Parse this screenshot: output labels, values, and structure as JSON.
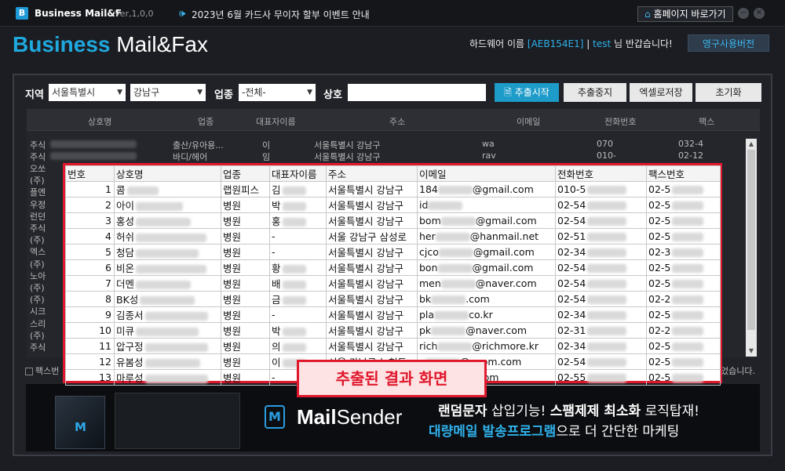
{
  "titlebar": {
    "logo_letter": "B",
    "app_name": "Business Mail&F",
    "version": "Ver,1,0,0",
    "notice": "2023년 6월 카드사 무이자 할부 이벤트 안내",
    "home_button": "홈페이지 바로가기"
  },
  "header": {
    "brand_bold": "Business",
    "brand_rest": "Mail&Fax",
    "hw_prefix": "하드웨어 이름",
    "hw_id": "[AEB154E1]",
    "sep": "|",
    "user": "test",
    "greeting": "님 반갑습니다!",
    "permanent_button": "영구사용버전"
  },
  "search": {
    "region_label": "지역",
    "region_value": "서울특별시",
    "district_value": "강남구",
    "industry_label": "업종",
    "industry_value": "-전체-",
    "company_label": "상호",
    "start_button": "추출시작",
    "stop_button": "추출중지",
    "excel_button": "엑셀로저장",
    "reset_button": "초기화"
  },
  "grid": {
    "headers": [
      "상호명",
      "업종",
      "대표자이름",
      "주소",
      "이메일",
      "전화번호",
      "팩스"
    ],
    "row1": {
      "name": "주식",
      "industry": "출산/유아용...",
      "rep": "이",
      "addr": "서울특별시 강남구",
      "email": "wa",
      "tel": "070",
      "fax": "032-4"
    },
    "row2": {
      "name": "주식",
      "industry": "바디/헤어",
      "rep": "임",
      "addr": "서울특별시 강남구",
      "email": "rav",
      "tel": "010-",
      "fax": "02-12"
    },
    "left_names": [
      "오쏘",
      "(주)",
      "플엔",
      "우정",
      "런던",
      "주식",
      "(주)",
      "엑스",
      "(주)",
      "노아",
      "(주)",
      "(주)",
      "시크",
      "스리",
      "(주)",
      "주식"
    ],
    "fax_check_label": "팩스번",
    "right_note": "었습니다."
  },
  "popup": {
    "headers": [
      "번호",
      "상호명",
      "업종",
      "대표자이름",
      "주소",
      "이메일",
      "전화번호",
      "팩스번호"
    ],
    "rows": [
      {
        "no": "1",
        "name": "콤",
        "industry": "랩원피스",
        "rep": "김",
        "addr": "서울특별시 강남구",
        "email_pre": "184",
        "email_post": "@gmail.com",
        "tel": "010-5",
        "fax": "02-5"
      },
      {
        "no": "2",
        "name": "아이",
        "industry": "병원",
        "rep": "박",
        "addr": "서울특별시 강남구",
        "email_pre": "id",
        "email_post": "",
        "tel": "02-54",
        "fax": "02-5"
      },
      {
        "no": "3",
        "name": "홍성",
        "industry": "병원",
        "rep": "홍",
        "addr": "서울특별시 강남구",
        "email_pre": "bom",
        "email_post": "@gmail.com",
        "tel": "02-54",
        "fax": "02-5"
      },
      {
        "no": "4",
        "name": "허쉬",
        "industry": "병원",
        "rep": "-",
        "addr": "서울 강남구 삼성로",
        "email_pre": "her",
        "email_post": "@hanmail.net",
        "tel": "02-51",
        "fax": "02-5"
      },
      {
        "no": "5",
        "name": "청담",
        "industry": "병원",
        "rep": "-",
        "addr": "서울특별시 강남구",
        "email_pre": "cjco",
        "email_post": "@gmail.com",
        "tel": "02-34",
        "fax": "02-3"
      },
      {
        "no": "6",
        "name": "비온",
        "industry": "병원",
        "rep": "황",
        "addr": "서울특별시 강남구",
        "email_pre": "bon",
        "email_post": "@gmail.com",
        "tel": "02-54",
        "fax": "02-5"
      },
      {
        "no": "7",
        "name": "더멘",
        "industry": "병원",
        "rep": "배",
        "addr": "서울특별시 강남구",
        "email_pre": "men",
        "email_post": "@naver.com",
        "tel": "02-54",
        "fax": "02-5"
      },
      {
        "no": "8",
        "name": "BK성",
        "industry": "병원",
        "rep": "금",
        "addr": "서울특별시 강남구",
        "email_pre": "bk",
        "email_post": ".com",
        "tel": "02-54",
        "fax": "02-2"
      },
      {
        "no": "9",
        "name": "김종서",
        "industry": "병원",
        "rep": "-",
        "addr": "서울특별시 강남구",
        "email_pre": "pla",
        "email_post": "co.kr",
        "tel": "02-34",
        "fax": "02-5"
      },
      {
        "no": "10",
        "name": "미큐",
        "industry": "병원",
        "rep": "박",
        "addr": "서울특별시 강남구",
        "email_pre": "pk",
        "email_post": "@naver.com",
        "tel": "02-31",
        "fax": "02-2"
      },
      {
        "no": "11",
        "name": "압구정",
        "industry": "병원",
        "rep": "의",
        "addr": "서울특별시 강남구",
        "email_pre": "rich",
        "email_post": "@richmore.kr",
        "tel": "02-34",
        "fax": "02-5"
      },
      {
        "no": "12",
        "name": "유봄성",
        "industry": "병원",
        "rep": "이",
        "addr": "서울 강남구 논현동",
        "email_pre": "u",
        "email_post": "@uvom.com",
        "tel": "02-54",
        "fax": "02-5"
      },
      {
        "no": "13",
        "name": "마루성",
        "industry": "병원",
        "rep": "-",
        "addr": "서울특별시 강남구",
        "email_pre": "",
        "email_post": "mail.com",
        "tel": "02-55",
        "fax": "02-5"
      }
    ]
  },
  "callout": "추출된 결과 화면",
  "banner": {
    "product_letter": "M",
    "name_bold": "Mail",
    "name_rest": "Sender",
    "line1_a": "랜덤문자",
    "line1_b": "삽입기능!",
    "line1_c": "스팸제제 최소화",
    "line1_d": "로직탑재!",
    "line2_a": "대량메일 발송프로그램",
    "line2_b": "으로 더 간단한 마케팅"
  },
  "colors": {
    "accent": "#1fa8de",
    "highlight": "#e0182d"
  }
}
